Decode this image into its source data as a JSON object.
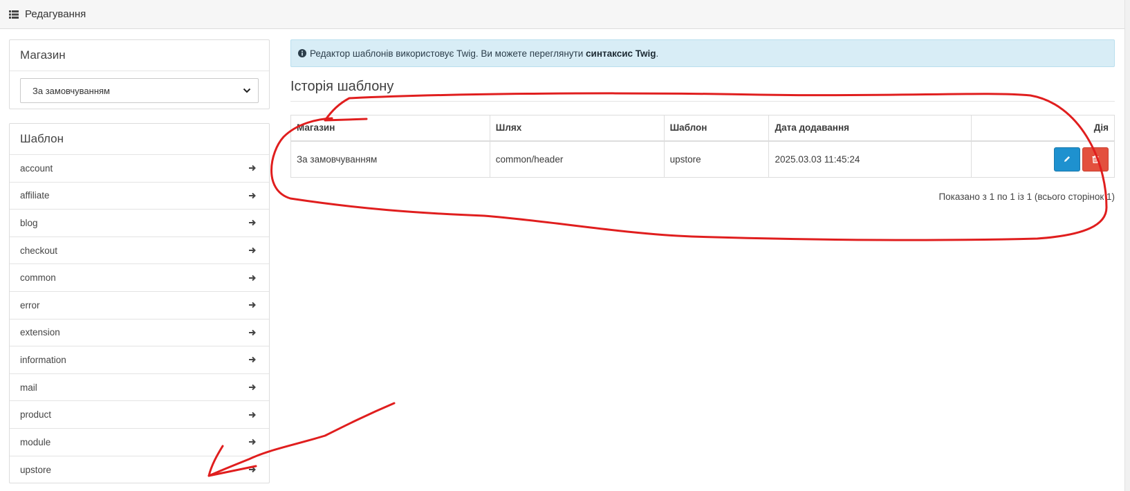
{
  "header": {
    "title": "Редагування",
    "icon": "list-icon"
  },
  "store_panel": {
    "title": "Магазин",
    "select_value": "За замовчуванням"
  },
  "template_panel": {
    "title": "Шаблон",
    "items": [
      {
        "label": "account"
      },
      {
        "label": "affiliate"
      },
      {
        "label": "blog"
      },
      {
        "label": "checkout"
      },
      {
        "label": "common"
      },
      {
        "label": "error"
      },
      {
        "label": "extension"
      },
      {
        "label": "information"
      },
      {
        "label": "mail"
      },
      {
        "label": "product"
      },
      {
        "label": "module"
      },
      {
        "label": "upstore"
      }
    ]
  },
  "alert": {
    "text": "Редактор шаблонів використовує Twig. Ви можете переглянути ",
    "link": "синтаксис Twig",
    "suffix": "."
  },
  "history": {
    "title": "Історія шаблону",
    "columns": [
      "Магазин",
      "Шлях",
      "Шаблон",
      "Дата додавання",
      "Дія"
    ],
    "rows": [
      [
        "За замовчуванням",
        "common/header",
        "upstore",
        "2025.03.03 11:45:24"
      ]
    ],
    "pagination": "Показано з 1 по 1 із 1 (всього сторінок 1)"
  },
  "colors": {
    "edit_button": "#1e91cf",
    "delete_button": "#e3503e",
    "alert_bg": "#d8edf6",
    "annotation": "#e01e1e"
  }
}
